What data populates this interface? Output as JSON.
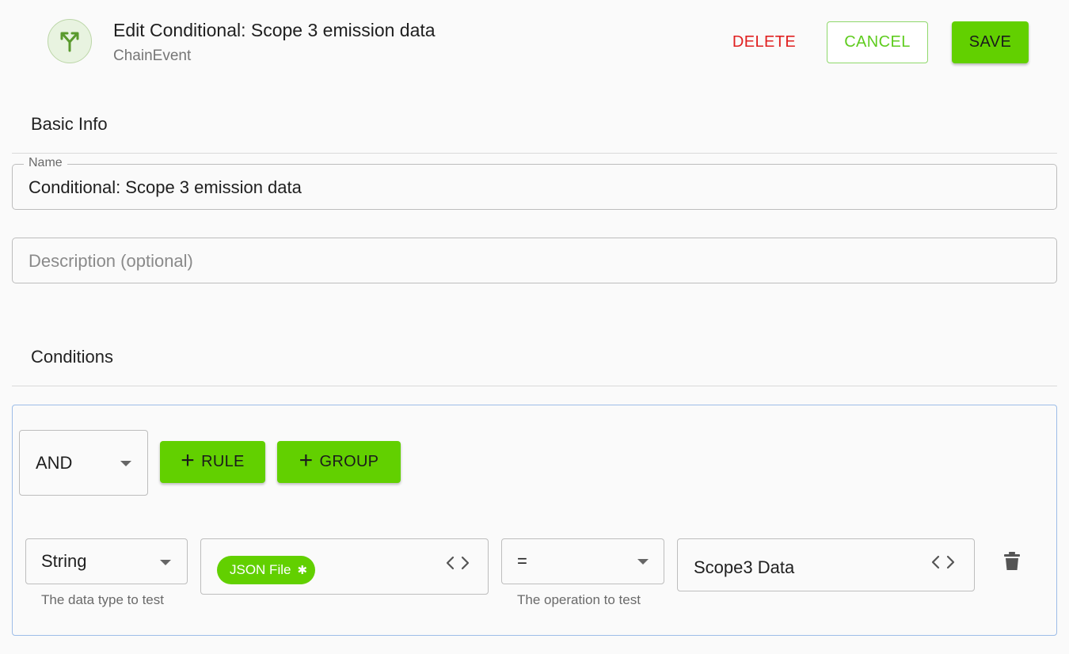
{
  "header": {
    "title": "Edit Conditional: Scope 3 emission data",
    "subtitle": "ChainEvent",
    "icon": "fork-arrows-icon",
    "delete_label": "DELETE",
    "cancel_label": "CANCEL",
    "save_label": "SAVE"
  },
  "basic_info": {
    "section_title": "Basic Info",
    "name_label": "Name",
    "name_value": "Conditional: Scope 3 emission data",
    "description_placeholder": "Description (optional)"
  },
  "conditions": {
    "section_title": "Conditions",
    "combinator": "AND",
    "add_rule_label": "RULE",
    "add_group_label": "GROUP",
    "rule": {
      "data_type": "String",
      "data_type_helper": "The data type to test",
      "field_chip": "JSON File",
      "operator": "=",
      "operator_helper": "The operation to test",
      "value": "Scope3 Data"
    }
  },
  "colors": {
    "accent_green": "#62d000",
    "delete_red": "#e02020",
    "focus_border": "#9dbde8"
  }
}
